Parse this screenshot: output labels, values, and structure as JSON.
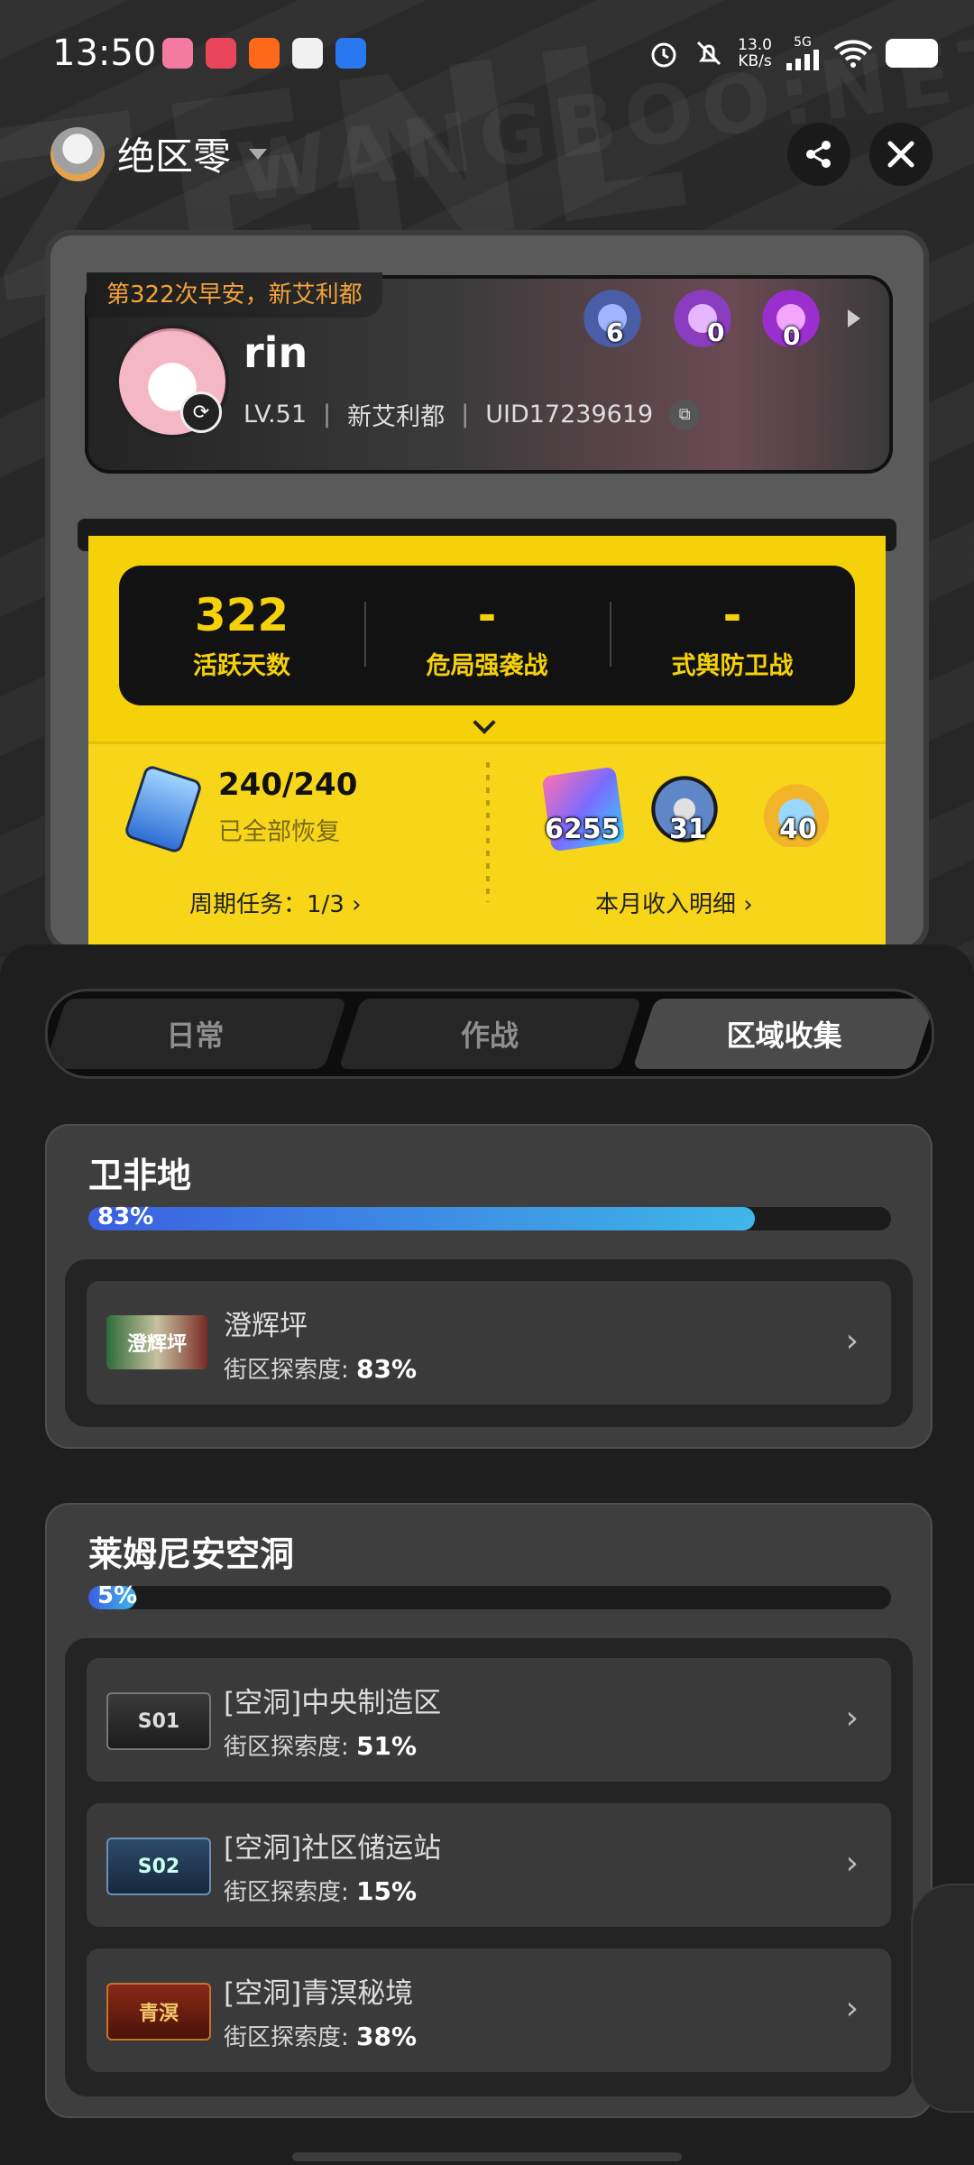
{
  "status_bar": {
    "time": "13:50",
    "network_speed": "13.0",
    "network_unit": "KB/s",
    "network_type": "5G",
    "icons": [
      "alarm-icon",
      "mute-icon",
      "signal-icon",
      "wifi-icon",
      "battery-icon"
    ]
  },
  "header": {
    "app_name": "绝区零",
    "share_icon": "share-icon",
    "close_icon": "close-icon"
  },
  "profile": {
    "greeting": "第322次早安，新艾利都",
    "username": "rin",
    "level": "LV.51",
    "server": "新艾利都",
    "uid": "UID17239619",
    "badges": [
      {
        "name": "rank-badge",
        "count": "6"
      },
      {
        "name": "crown-badge",
        "count": "0"
      },
      {
        "name": "purple-badge",
        "count": "0"
      }
    ]
  },
  "stats": [
    {
      "value": "322",
      "label": "活跃天数"
    },
    {
      "value": "-",
      "label": "危局强袭战"
    },
    {
      "value": "-",
      "label": "式舆防卫战"
    }
  ],
  "energy": {
    "value": "240/240",
    "status": "已全部恢复"
  },
  "resources": [
    {
      "name": "film-icon",
      "count": "6255"
    },
    {
      "name": "reel-icon",
      "count": "31"
    },
    {
      "name": "trophy-icon",
      "count": "40"
    }
  ],
  "links": {
    "weekly": "周期任务：1/3 ›",
    "monthly": "本月收入明细 ›"
  },
  "tabs": [
    {
      "label": "日常",
      "active": false
    },
    {
      "label": "作战",
      "active": false
    },
    {
      "label": "区域收集",
      "active": true
    }
  ],
  "regions": [
    {
      "title": "卫非地",
      "progress_label": "83%",
      "progress": 0.83,
      "areas": [
        {
          "name": "澄辉坪",
          "sub_label": "街区探索度: ",
          "value": "83%",
          "icon_text": "澄辉坪"
        }
      ]
    },
    {
      "title": "莱姆尼安空洞",
      "progress_label": "5%",
      "progress": 0.05,
      "areas": [
        {
          "name": "[空洞]中央制造区",
          "sub_label": "街区探索度: ",
          "value": "51%",
          "icon_text": "S01"
        },
        {
          "name": "[空洞]社区储运站",
          "sub_label": "街区探索度: ",
          "value": "15%",
          "icon_text": "S02"
        },
        {
          "name": "[空洞]青溟秘境",
          "sub_label": "街区探索度: ",
          "value": "38%",
          "icon_text": "青溟"
        }
      ]
    }
  ],
  "colors": {
    "accent_yellow": "#f5d10a",
    "progress_start": "#3b5fe0",
    "progress_end": "#3fb7e8",
    "greeting_orange": "#f4a23b"
  }
}
